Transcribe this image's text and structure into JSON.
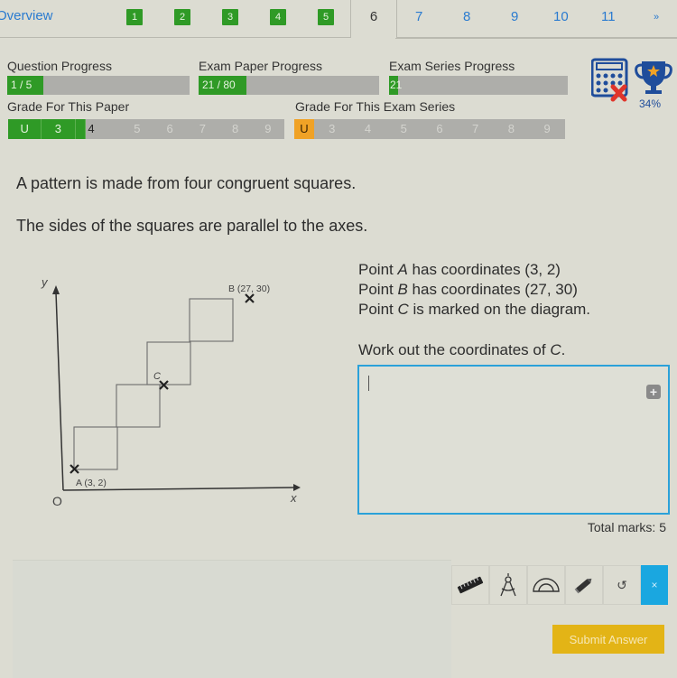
{
  "nav": {
    "overview_label": "Overview",
    "question_buttons": [
      {
        "label": "1",
        "status": "done"
      },
      {
        "label": "2",
        "status": "done"
      },
      {
        "label": "3",
        "status": "done"
      },
      {
        "label": "4",
        "status": "done"
      },
      {
        "label": "5",
        "status": "done"
      }
    ],
    "current_tab": "6",
    "question_links": [
      "7",
      "8",
      "9",
      "10",
      "11"
    ],
    "next_label": "»"
  },
  "progress": {
    "question": {
      "label": "Question Progress",
      "value": "1 / 5",
      "fraction": 0.2
    },
    "exam_paper": {
      "label": "Exam Paper Progress",
      "value": "21 / 80",
      "fraction": 0.2625
    },
    "exam_series": {
      "label": "Exam Series Progress",
      "value": "21",
      "fraction": 0.05
    },
    "grade_paper": {
      "label": "Grade For This Paper",
      "grades": [
        "U",
        "3",
        "",
        "4",
        "5",
        "6",
        "7",
        "8",
        "9"
      ],
      "achieved": [
        "U",
        "3"
      ],
      "current": "4"
    },
    "grade_series": {
      "label": "Grade For This Exam Series",
      "grades": [
        "U",
        "3",
        "4",
        "5",
        "6",
        "7",
        "8",
        "9"
      ],
      "current": "U"
    }
  },
  "status_icons": {
    "calculator": {
      "icon": "calculator-icon",
      "allowed": false
    },
    "trophy": {
      "icon": "trophy-icon",
      "percent": "34%"
    }
  },
  "question": {
    "line1": "A pattern is made from four congruent squares.",
    "line2": "The sides of the squares are parallel to the axes.",
    "info": [
      {
        "pre": "Point ",
        "point": "A",
        "post": " has coordinates (3, 2)"
      },
      {
        "pre": "Point ",
        "point": "B",
        "post": " has coordinates (27, 30)"
      },
      {
        "pre": "Point ",
        "point": "C",
        "post": " is marked on the diagram."
      }
    ],
    "ask_pre": "Work out the coordinates of ",
    "ask_point": "C",
    "ask_post": ".",
    "diagram": {
      "y_label": "y",
      "x_label": "x",
      "origin_label": "O",
      "point_a_label": "A (3, 2)",
      "point_b_label": "B (27, 30)",
      "point_c_label": "C"
    }
  },
  "answer": {
    "value": "",
    "total_marks_label": "Total marks: 5"
  },
  "tools": [
    {
      "name": "ruler-tool",
      "icon": "ruler-icon"
    },
    {
      "name": "compass-tool",
      "icon": "compass-icon"
    },
    {
      "name": "protractor-tool",
      "icon": "protractor-icon"
    },
    {
      "name": "pencil-tool",
      "icon": "pencil-icon"
    },
    {
      "name": "undo-tool",
      "icon": "undo-icon",
      "glyph": "↺"
    },
    {
      "name": "close-tool",
      "icon": "close-icon",
      "glyph": "×"
    }
  ],
  "submit_label": "Submit Answer",
  "colors": {
    "green": "#2f9a26",
    "orange": "#f0a226",
    "blue_link": "#2a7bd0",
    "accent_blue": "#1aa7e0",
    "submit": "#e3b416"
  }
}
